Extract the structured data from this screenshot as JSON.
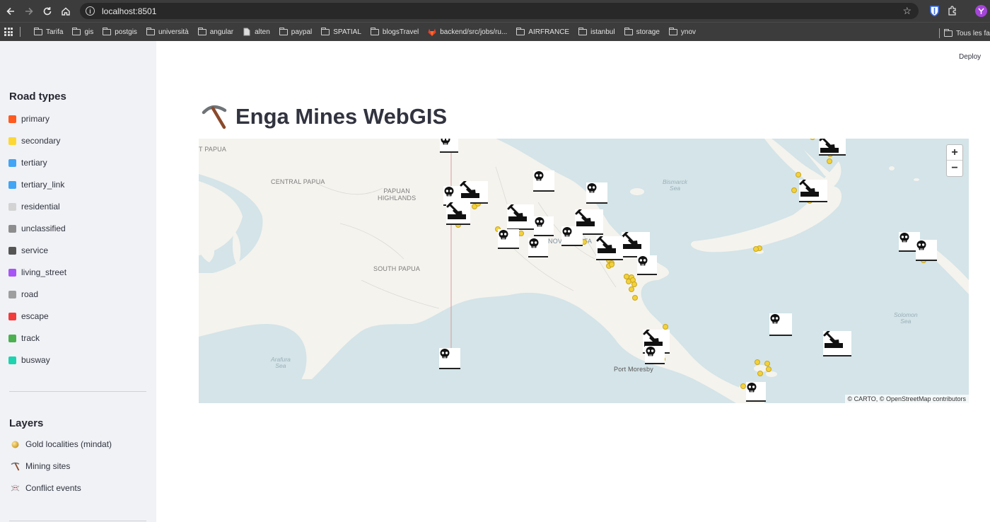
{
  "browser": {
    "url": "localhost:8501",
    "bookmarks": [
      {
        "label": "Tarifa",
        "icon": "folder-icon"
      },
      {
        "label": "gis",
        "icon": "folder-icon"
      },
      {
        "label": "postgis",
        "icon": "folder-icon"
      },
      {
        "label": "università",
        "icon": "folder-icon"
      },
      {
        "label": "angular",
        "icon": "folder-icon"
      },
      {
        "label": "alten",
        "icon": "page-icon"
      },
      {
        "label": "paypal",
        "icon": "folder-icon"
      },
      {
        "label": "SPATIAL",
        "icon": "folder-icon"
      },
      {
        "label": "blogsTravel",
        "icon": "folder-icon"
      },
      {
        "label": "backend/src/jobs/ru...",
        "icon": "gitlab-icon"
      },
      {
        "label": "AIRFRANCE",
        "icon": "folder-icon"
      },
      {
        "label": "istanbul",
        "icon": "folder-icon"
      },
      {
        "label": "storage",
        "icon": "folder-icon"
      },
      {
        "label": "ynov",
        "icon": "folder-icon"
      }
    ],
    "bookmarks_right": "Tous les fa"
  },
  "sidebar": {
    "road_types_title": "Road types",
    "road_types": [
      {
        "label": "primary",
        "color": "#ff5a1f"
      },
      {
        "label": "secondary",
        "color": "#fdd835"
      },
      {
        "label": "tertiary",
        "color": "#42a5f5"
      },
      {
        "label": "tertiary_link",
        "color": "#42a5f5"
      },
      {
        "label": "residential",
        "color": "#d3d3d3"
      },
      {
        "label": "unclassified",
        "color": "#8d8d8d"
      },
      {
        "label": "service",
        "color": "#555555"
      },
      {
        "label": "living_street",
        "color": "#a855f7"
      },
      {
        "label": "road",
        "color": "#9e9e9e"
      },
      {
        "label": "escape",
        "color": "#f23b3b"
      },
      {
        "label": "track",
        "color": "#4caf50"
      },
      {
        "label": "busway",
        "color": "#1dd3b0"
      }
    ],
    "layers_title": "Layers",
    "layers": [
      {
        "label": "Gold localities (mindat)",
        "icon": "gold-coin-icon"
      },
      {
        "label": "Mining sites",
        "icon": "pickaxe-icon"
      },
      {
        "label": "Conflict events",
        "icon": "skull-icon"
      }
    ]
  },
  "main": {
    "deploy_label": "Deploy",
    "title": "Enga Mines WebGIS"
  },
  "map": {
    "labels": {
      "papua": "T PAPUA",
      "central_papua": "CENTRAL PAPUA",
      "papuan_highlands": "PAPUAN\nHIGHLANDS",
      "south_papua": "SOUTH PAPUA",
      "nov": "NOV",
      "ifa": "IFA",
      "bismarck_sea": "Bismarck\nSea",
      "solomon_sea": "Solomon\nSea",
      "arafura_sea": "Arafura\nSea",
      "port_moresby": "Port Moresby"
    },
    "zoom_in": "+",
    "zoom_out": "−",
    "attribution": "© CARTO, © OpenStreetMap contributors"
  }
}
